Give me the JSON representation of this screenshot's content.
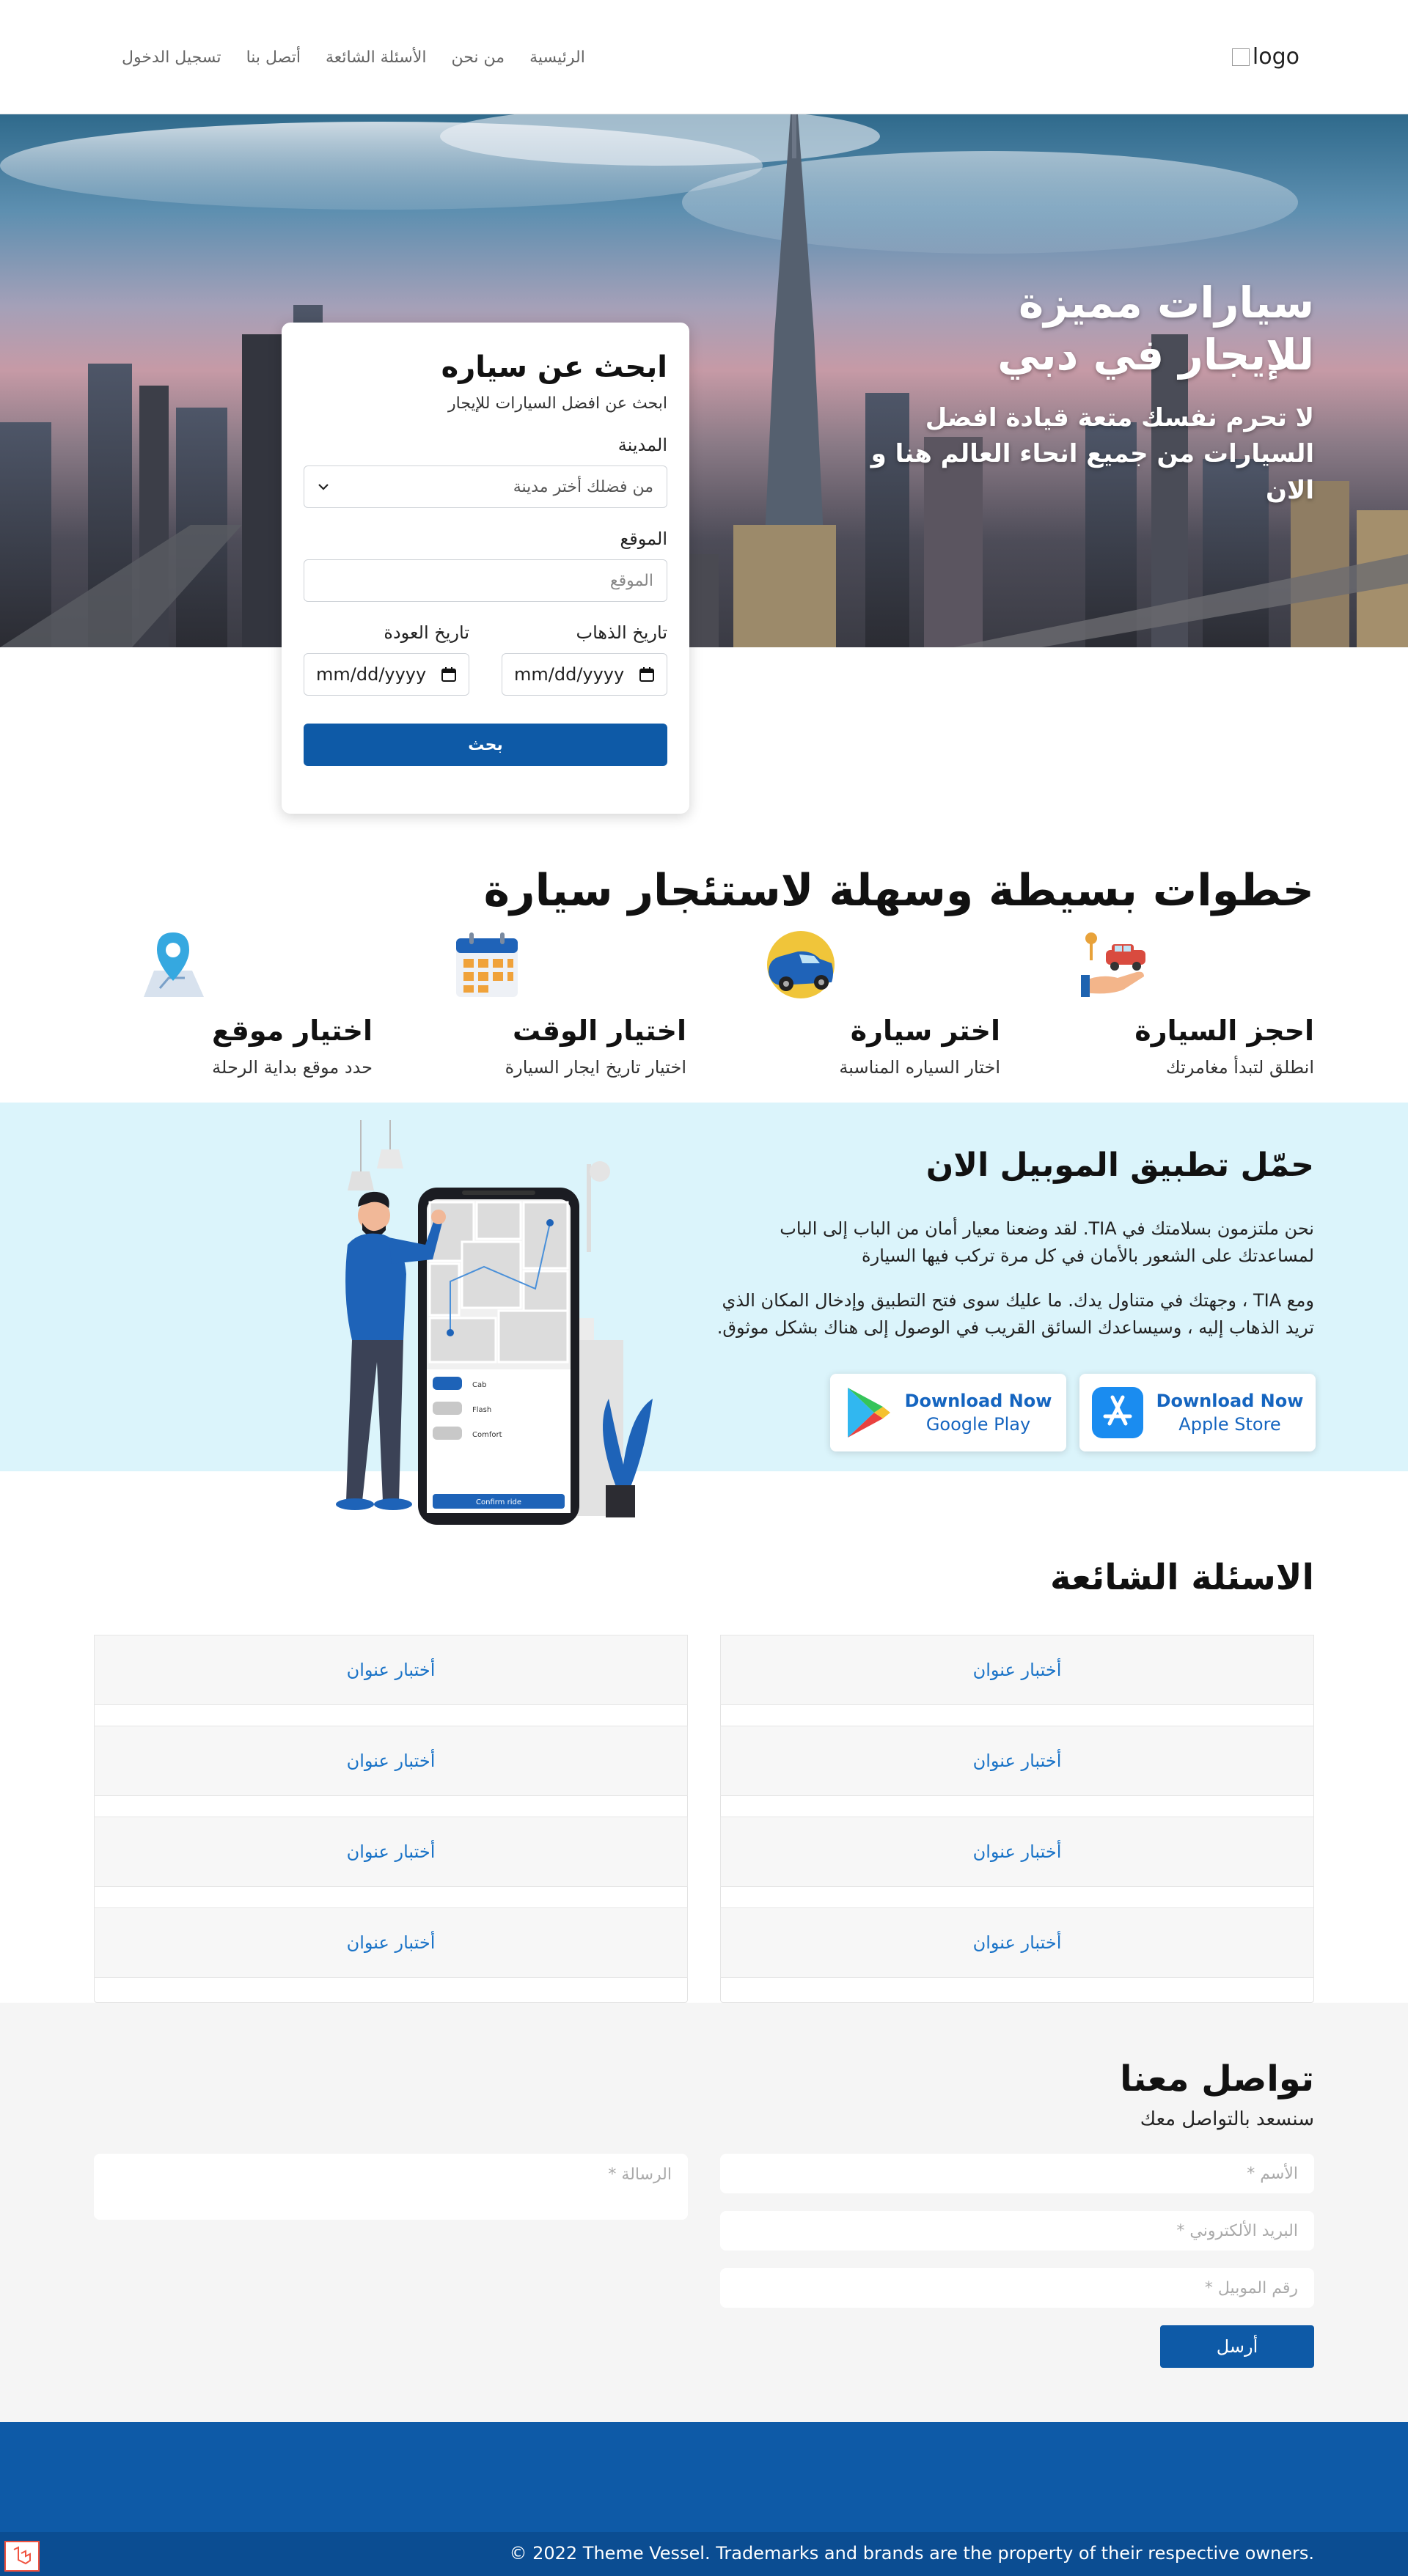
{
  "navbar": {
    "logo_alt": "logo",
    "links": [
      "الرئيسية",
      "من نحن",
      "الأسئلة الشائعة",
      "أتصل بنا",
      "تسجيل الدخول"
    ]
  },
  "hero": {
    "title": "سيارات مميزة للإيجار في دبي",
    "subtitle": "لا تحرم نفسك متعة قيادة افضل السيارات من جميع انحاء العالم هنا و الان"
  },
  "search": {
    "title": "ابحث عن سياره",
    "subtitle": "ابحث عن افضل السيارات للإيجار",
    "city_label": "المدينة",
    "city_value": "من فضلك أختر مدينة",
    "location_label": "الموقع",
    "location_placeholder": "الموقع",
    "departure_label": "تاريخ الذهاب",
    "return_label": "تاريخ العودة",
    "date_placeholder": "mm/dd/yyyy",
    "button": "بحث"
  },
  "steps": {
    "title": "خطوات بسيطة وسهلة لاستئجار سيارة",
    "items": [
      {
        "title": "احجز السيارة",
        "desc": "انطلق لتبدأ مغامرتك",
        "icon": "car-key-hand-icon"
      },
      {
        "title": "اختر سيارة",
        "desc": "اختار السياره المناسبة",
        "icon": "blue-car-icon"
      },
      {
        "title": "اختيار الوقت",
        "desc": "اختيار تاريخ ايجار السيارة",
        "icon": "calendar-icon"
      },
      {
        "title": "اختيار موقع",
        "desc": "حدد موقع بداية الرحلة",
        "icon": "map-pin-icon"
      }
    ]
  },
  "app": {
    "title": "حمّل تطبيق الموبيل الان",
    "p1": "نحن ملتزمون بسلامتك في TIA. لقد وضعنا معيار أمان من الباب إلى الباب لمساعدتك على الشعور بالأمان في كل مرة تركب فيها السيارة",
    "p2": "ومع TIA ، وجهتك في متناول يدك. ما عليك سوى فتح التطبيق وإدخال المكان الذي تريد الذهاب إليه ، وسيساعدك السائق القريب في الوصول إلى هناك بشكل موثوق.",
    "apple": {
      "line1": "Download Now",
      "line2": "Apple Store"
    },
    "google": {
      "line1": "Download Now",
      "line2": "Google Play"
    },
    "phone_labels": {
      "cab": "Cab",
      "flash": "Flash",
      "comfort": "Comfort",
      "confirm": "Confirm ride"
    }
  },
  "faq": {
    "title": "الاسئلة الشائعة",
    "right": [
      "أختبار عنوان",
      "أختبار عنوان",
      "أختبار عنوان",
      "أختبار عنوان"
    ],
    "left": [
      "أختبار عنوان",
      "أختبار عنوان",
      "أختبار عنوان",
      "أختبار عنوان"
    ]
  },
  "contact": {
    "title": "تواصل معنا",
    "subtitle": "سنسعد بالتواصل معك",
    "name_placeholder": "الأسم *",
    "email_placeholder": "البريد الألكتروني *",
    "phone_placeholder": "رقم الموبيل *",
    "message_placeholder": "الرسالة *",
    "send": "أرسل"
  },
  "footer": {
    "copyright": "© 2022 Theme Vessel. Trademarks and brands are the property of their respective owners."
  },
  "colors": {
    "primary": "#0e5aa7",
    "app_bg": "#dbf4fb",
    "link": "#1a73c7"
  }
}
